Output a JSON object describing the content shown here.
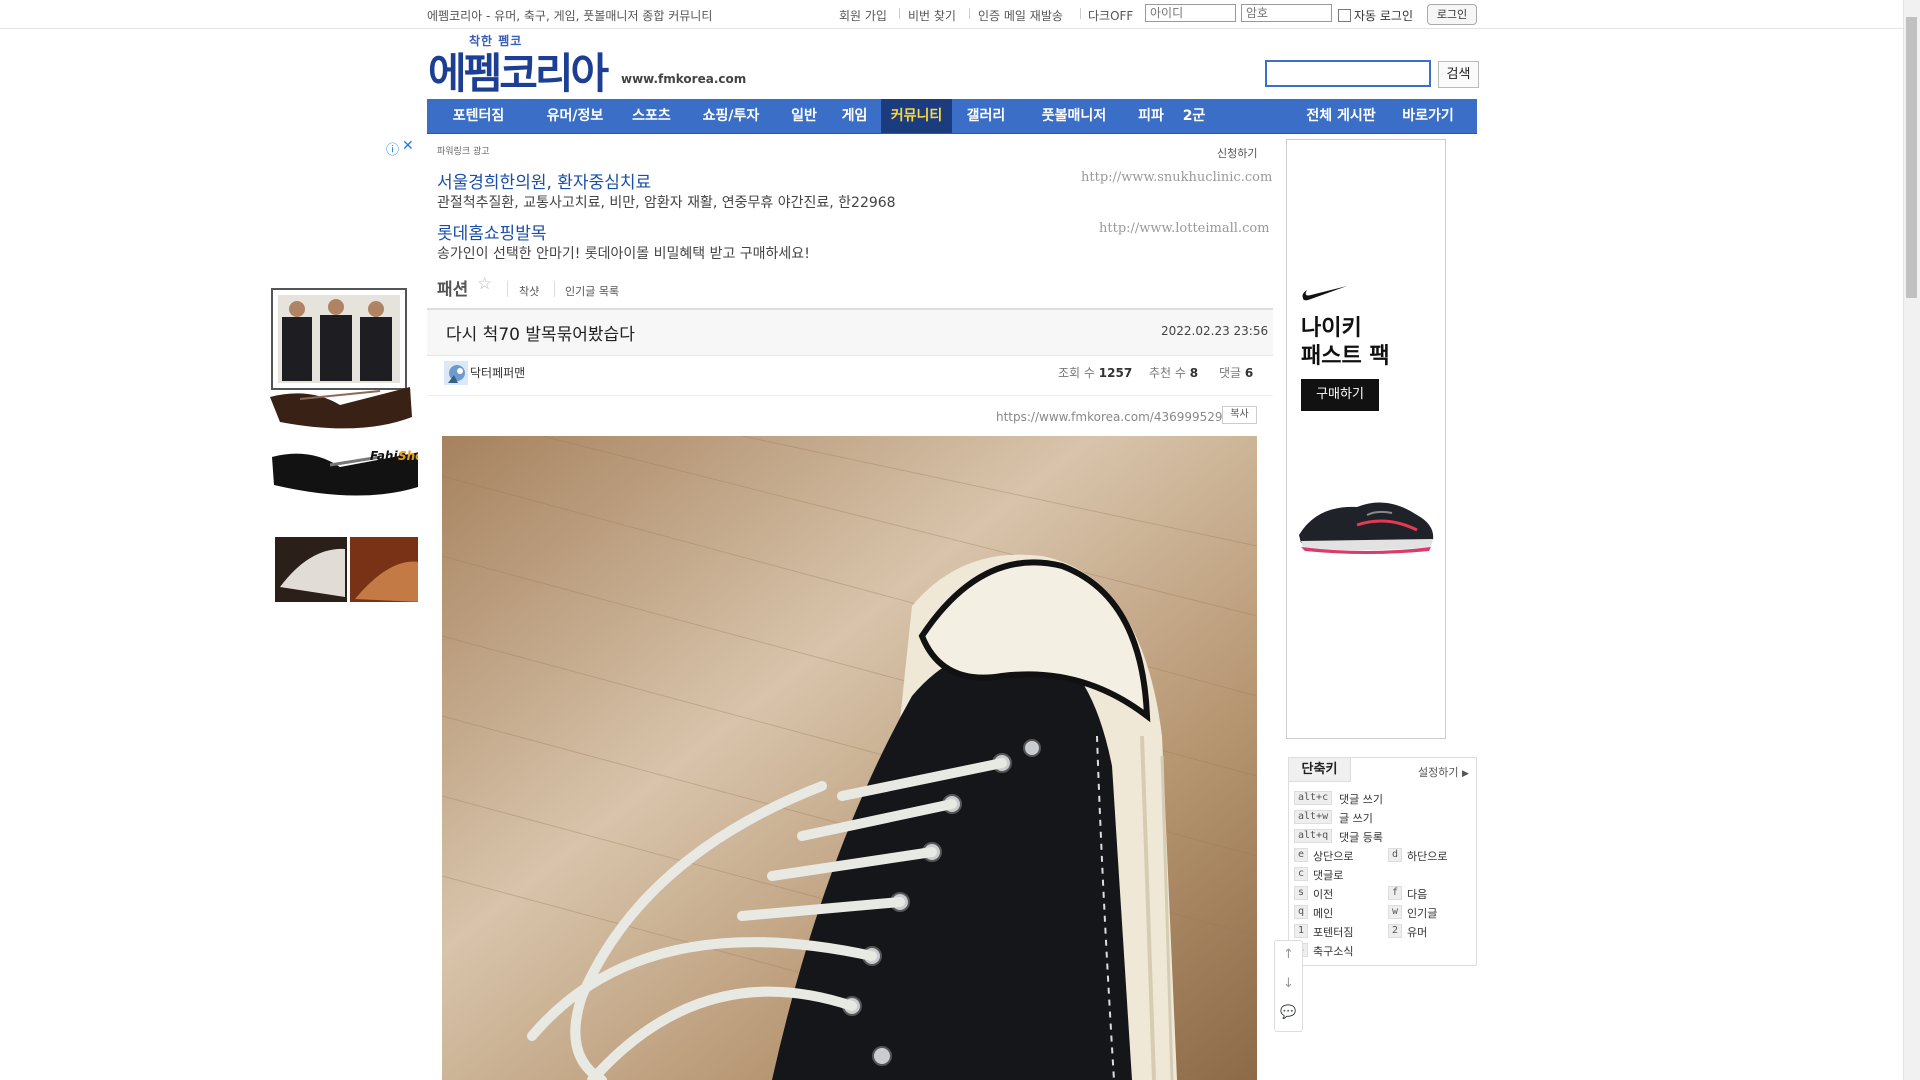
{
  "topbar": {
    "site_desc": "에펨코리아 - 유머, 축구, 게임, 풋볼매니저 종합 커뮤니티",
    "signup": "회원 가입",
    "find_password": "비번 찾기",
    "resend_mail": "인증 메일 재발송",
    "dark_off": "다크OFF",
    "id_placeholder": "아이디",
    "pw_placeholder": "암호",
    "auto_login": "자동 로그인",
    "login": "로그인"
  },
  "header": {
    "logo_small": "착한 펨코",
    "logo_main": "에펨코리아",
    "logo_url": "www.fmkorea.com",
    "search_button": "검색"
  },
  "nav": {
    "items": [
      "포텐터짐",
      "유머/정보",
      "스포츠",
      "쇼핑/투자",
      "일반",
      "게임",
      "커뮤니티",
      "갤러리",
      "풋볼매니저",
      "피파",
      "2군"
    ],
    "active": "커뮤니티",
    "right_items": [
      "전체 게시판",
      "바로가기"
    ]
  },
  "text_ads": {
    "powerlink": "파워링크 광고",
    "apply": "신청하기",
    "ads": [
      {
        "title": "서울경희한의원, 환자중심치료",
        "desc": "관절척추질환, 교통사고치료, 비만, 암환자 재활, 연중무휴 야간진료, 한22968",
        "url": "http://www.snukhuclinic.com"
      },
      {
        "title": "롯데홈쇼핑발목",
        "desc": "송가인이 선택한 안마기! 롯데아이몰 비밀혜택 받고 구매하세요!",
        "url": "http://www.lotteimall.com"
      }
    ]
  },
  "left_ad": {
    "brand": "FahinShop"
  },
  "right_ad": {
    "headline_1": "나이키",
    "headline_2": "패스트 팩",
    "cta": "구매하기"
  },
  "board": {
    "title": "패션",
    "links": [
      "착샷",
      "인기글 목록"
    ]
  },
  "post": {
    "title": "다시 척70 발목묶어봤습다",
    "date": "2022.02.23 23:56",
    "author": "닥터페퍼맨",
    "views_label": "조회 수",
    "views": "1257",
    "likes_label": "추천 수",
    "likes": "8",
    "comments_label": "댓글",
    "comments": "6",
    "url": "https://www.fmkorea.com/4369995298",
    "copy": "복사"
  },
  "shortcuts": {
    "title": "단축키",
    "setting": "설정하기",
    "items": [
      {
        "key": "alt+c",
        "label": "댓글 쓰기"
      },
      {
        "key": "alt+w",
        "label": "글 쓰기"
      },
      {
        "key": "alt+q",
        "label": "댓글 등록"
      },
      {
        "key": "e",
        "label": "상단으로"
      },
      {
        "key": "d",
        "label": "하단으로"
      },
      {
        "key": "c",
        "label": "댓글로"
      },
      {
        "key": "s",
        "label": "이전"
      },
      {
        "key": "f",
        "label": "다음"
      },
      {
        "key": "q",
        "label": "메인"
      },
      {
        "key": "w",
        "label": "인기글"
      },
      {
        "key": "1",
        "label": "포텐터짐"
      },
      {
        "key": "2",
        "label": "유머"
      },
      {
        "key": "3",
        "label": "축구소식"
      }
    ]
  },
  "colors": {
    "brand_blue": "#3b6fc7",
    "nav_active_bg": "#1b3d7f",
    "nav_active_text": "#ffd83b"
  }
}
